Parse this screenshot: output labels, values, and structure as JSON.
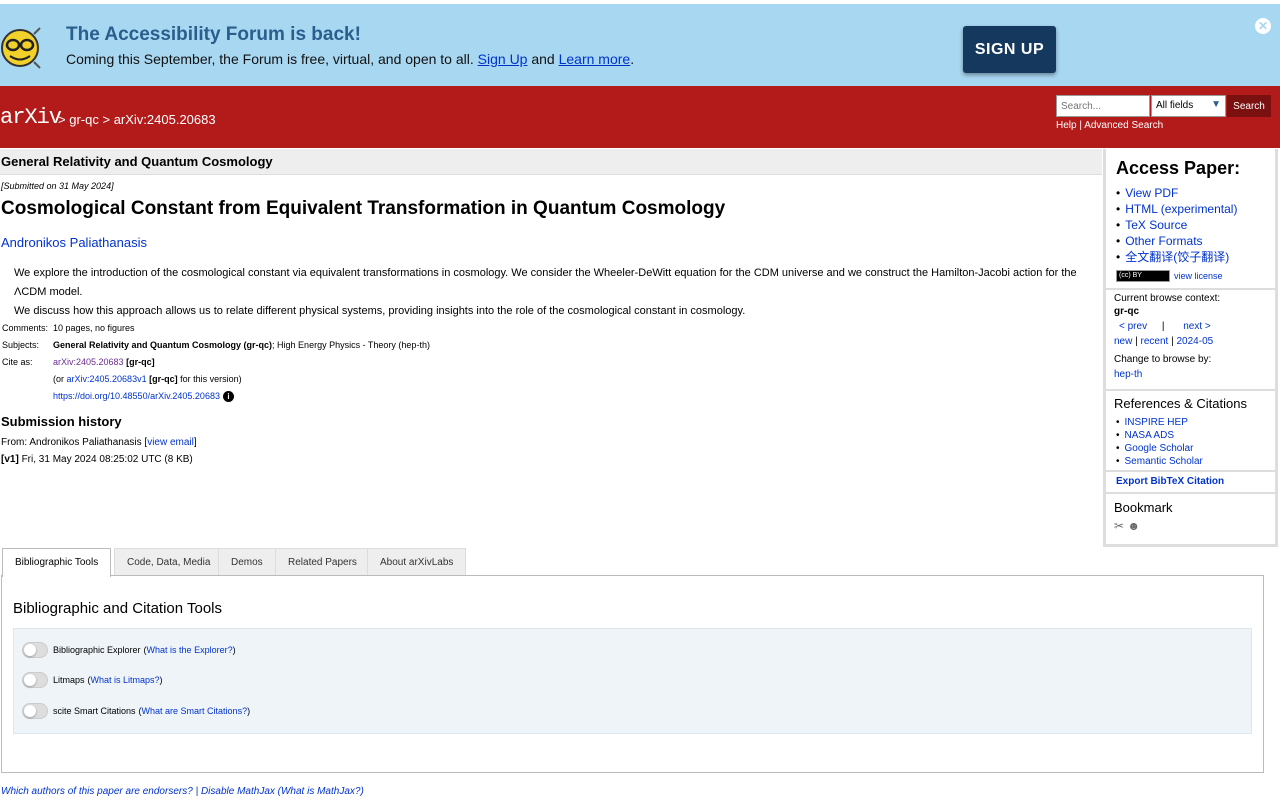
{
  "banner": {
    "title": "The Accessibility Forum is back!",
    "text_before": "Coming this September, the Forum is free, virtual, and open to all.",
    "signup_link": "Sign Up",
    "and_text": "and",
    "learn_more": "Learn more",
    "period": ".",
    "signup_button": "SIGN UP",
    "close_icon": "close-icon",
    "close_glyph": "✕"
  },
  "header": {
    "logo": "arXiv",
    "sep1": ">",
    "crumb1": "gr-qc",
    "sep2": ">",
    "crumb2": "arXiv:2405.20683",
    "search_placeholder": "Search...",
    "search_field": "All fields",
    "search_button": "Search",
    "help": "Help",
    "pipe": "|",
    "advanced": "Advanced Search"
  },
  "paper": {
    "subject_bar": "General Relativity and Quantum Cosmology",
    "submitted": "[Submitted on 31 May 2024]",
    "title": "Cosmological Constant from Equivalent Transformation in Quantum Cosmology",
    "author": "Andronikos Paliathanasis",
    "abstract_1": "We explore the introduction of the cosmological constant via equivalent transformations in cosmology. We consider the Wheeler-DeWitt equation for the CDM universe and we construct the Hamilton-Jacobi action for the ΛCDM model.",
    "abstract_2": "We discuss how this approach allows us to relate different physical systems, providing insights into the role of the cosmological constant in cosmology.",
    "comments_label": "Comments:",
    "comments": "10 pages, no figures",
    "subjects_label": "Subjects:",
    "subjects_main": "General Relativity and Quantum Cosmology (gr-qc)",
    "subjects_rest": "; High Energy Physics - Theory (hep-th)",
    "cite_label": "Cite as:",
    "cite_id": "arXiv:2405.20683",
    "cite_tag": "[gr-qc]",
    "or_text": "(or",
    "cite_v1": "arXiv:2405.20683v1",
    "cite_v1_tag": "[gr-qc]",
    "for_version": "for this version)",
    "doi": "https://doi.org/10.48550/arXiv.2405.20683",
    "history_title": "Submission history",
    "from_text": "From: Andronikos Paliathanasis",
    "view_email": "view email",
    "bracket_open": "[",
    "bracket_close": "]",
    "v1_label": "[v1]",
    "v1_text": "Fri, 31 May 2024 08:25:02 UTC (8 KB)"
  },
  "sidebar": {
    "access_title": "Access Paper:",
    "access_links": [
      "View PDF",
      "HTML (experimental)",
      "TeX Source",
      "Other Formats",
      "全文翻译(饺子翻译)"
    ],
    "cc_badge": "(cc) BY",
    "view_license": "view license",
    "browse_context_label": "Current browse context:",
    "browse_context": "gr-qc",
    "prev": "< prev",
    "sep": "|",
    "next": "next >",
    "new": "new",
    "recent": "recent",
    "month": "2024-05",
    "change_browse": "Change to browse by:",
    "hep_th": "hep-th",
    "refs_title": "References & Citations",
    "refs": [
      "INSPIRE HEP",
      "NASA ADS",
      "Google Scholar",
      "Semantic Scholar"
    ],
    "export": "Export BibTeX Citation",
    "bookmark": "Bookmark"
  },
  "tabs": [
    "Bibliographic Tools",
    "Code, Data, Media",
    "Demos",
    "Related Papers",
    "About arXivLabs"
  ],
  "tools": {
    "title": "Bibliographic and Citation Tools",
    "items": [
      {
        "label": "Bibliographic Explorer",
        "link": "What is the Explorer?"
      },
      {
        "label": "Litmaps",
        "link": "What is Litmaps?"
      },
      {
        "label": "scite Smart Citations",
        "link": "What are Smart Citations?"
      }
    ]
  },
  "footer": {
    "endorsers": "Which authors of this paper are endorsers?",
    "pipe": "|",
    "disable_mathjax": "Disable MathJax",
    "what_mathjax": "(What is MathJax?)"
  }
}
